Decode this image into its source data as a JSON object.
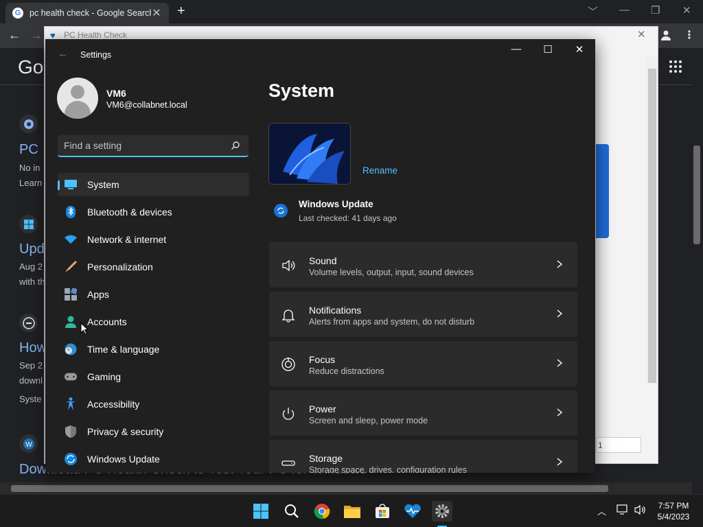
{
  "browser": {
    "tab_title": "pc health check - Google Search",
    "tab_close": "✕",
    "new_tab": "+",
    "win_controls": [
      "﹀",
      "—",
      "❐",
      "✕"
    ],
    "back": "←",
    "forward": "→",
    "menu": "⋮"
  },
  "google": {
    "logo": "Go",
    "results": [
      {
        "title": "PC",
        "lines": [
          "No in",
          "Learn"
        ]
      },
      {
        "title": "Upd",
        "lines": [
          "Aug 2",
          "with th"
        ]
      },
      {
        "title": "How",
        "lines": [
          "Sep 2",
          "downl",
          "Syste"
        ]
      },
      {
        "title": "Download PC Health Check to Test Your PC for Windows",
        "lines": []
      }
    ]
  },
  "pc_health_check": {
    "title": "PC Health Check",
    "close": "✕",
    "field_value": "1"
  },
  "settings": {
    "window_title": "Settings",
    "back": "←",
    "controls": {
      "minimize": "—",
      "maximize": "☐",
      "close": "✕"
    },
    "user": {
      "name": "VM6",
      "email": "VM6@collabnet.local"
    },
    "search_placeholder": "Find a setting",
    "nav": [
      {
        "label": "System",
        "icon": "system-icon",
        "active": true
      },
      {
        "label": "Bluetooth & devices",
        "icon": "bluetooth-icon"
      },
      {
        "label": "Network & internet",
        "icon": "wifi-icon"
      },
      {
        "label": "Personalization",
        "icon": "brush-icon"
      },
      {
        "label": "Apps",
        "icon": "apps-icon"
      },
      {
        "label": "Accounts",
        "icon": "accounts-icon"
      },
      {
        "label": "Time & language",
        "icon": "time-language-icon"
      },
      {
        "label": "Gaming",
        "icon": "gamepad-icon"
      },
      {
        "label": "Accessibility",
        "icon": "accessibility-icon"
      },
      {
        "label": "Privacy & security",
        "icon": "shield-icon"
      },
      {
        "label": "Windows Update",
        "icon": "windows-update-icon"
      }
    ],
    "main": {
      "heading": "System",
      "rename": "Rename",
      "update": {
        "title": "Windows Update",
        "subtitle": "Last checked: 41 days ago"
      },
      "cards": [
        {
          "title": "Sound",
          "subtitle": "Volume levels, output, input, sound devices",
          "icon": "speaker-icon"
        },
        {
          "title": "Notifications",
          "subtitle": "Alerts from apps and system, do not disturb",
          "icon": "bell-icon"
        },
        {
          "title": "Focus",
          "subtitle": "Reduce distractions",
          "icon": "focus-icon"
        },
        {
          "title": "Power",
          "subtitle": "Screen and sleep, power mode",
          "icon": "power-icon"
        },
        {
          "title": "Storage",
          "subtitle": "Storage space, drives, configuration rules",
          "icon": "storage-icon"
        }
      ]
    }
  },
  "taskbar": {
    "apps": [
      "start-icon",
      "search-icon",
      "chrome-icon",
      "file-explorer-icon",
      "store-icon",
      "pc-health-check-icon",
      "settings-icon"
    ],
    "tray_chevron": "︿",
    "time": "7:57 PM",
    "date": "5/4/2023"
  },
  "colors": {
    "accent": "#4cc2ff",
    "settings_bg": "#202020",
    "card_bg": "#2b2b2b",
    "chrome_bg": "#202124",
    "link": "#8ab4f8"
  }
}
